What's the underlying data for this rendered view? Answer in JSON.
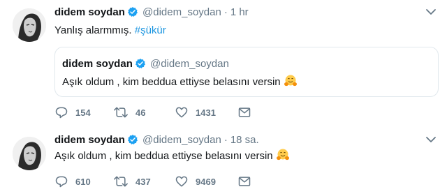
{
  "tweets": [
    {
      "author_name": "didem soydan",
      "handle": "@didem_soydan",
      "separator": "·",
      "time": "1 hr",
      "text": "Yanlış alarmmış. ",
      "hashtag": "#şükür",
      "quoted": {
        "author_name": "didem soydan",
        "handle": "@didem_soydan",
        "text": "Aşık oldum , kim beddua ettiyse belasını versin"
      },
      "replies": "154",
      "retweets": "46",
      "likes": "1431"
    },
    {
      "author_name": "didem soydan",
      "handle": "@didem_soydan",
      "separator": "·",
      "time": "18 sa.",
      "text": "Aşık oldum , kim beddua ettiyse belasını versin",
      "replies": "610",
      "retweets": "437",
      "likes": "9469"
    }
  ],
  "colors": {
    "text": "#14171a",
    "secondary": "#657786",
    "link": "#1b95e0",
    "verified": "#1da1f2",
    "border": "#e1e8ed"
  },
  "icons": [
    "verified-badge-icon",
    "chevron-down-icon",
    "reply-icon",
    "retweet-icon",
    "like-icon",
    "direct-message-icon",
    "hugging-face-emoji"
  ]
}
